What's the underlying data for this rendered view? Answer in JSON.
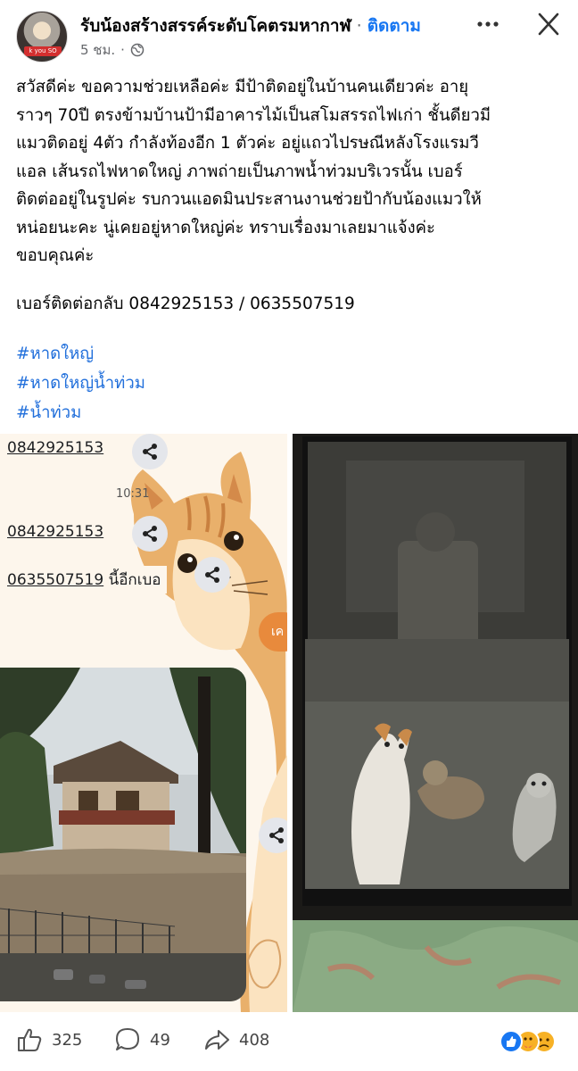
{
  "header": {
    "page_name": "รับน้องสร้างสรรค์ระดับโคตรมหากาฬ",
    "separator": " · ",
    "follow_label": "ติดตาม",
    "time_ago": "5 ชม.",
    "dot": "·",
    "avatar_tag": "k you SO"
  },
  "post": {
    "lines": [
      "สวัสดีค่ะ ขอความช่วยเหลือค่ะ มีป้าติดอยู่ในบ้านคนเดียวค่ะ อายุ",
      "ราวๆ 70ปี ตรงข้ามบ้านป้ามีอาคารไม้เป็นสโมสรรถไฟเก่า ชั้นดียวมี",
      "แมวติดอยู่ 4ตัว กำลังท้องอีก 1 ตัวค่ะ อยู่แถวไปรษณีหลังโรงแรมวี",
      "แอล เส้นรถไฟหาดใหญ่ ภาพถ่ายเป็นภาพน้ำท่วมบริเวรนั้น เบอร์",
      "ติดต่ออยู่ในรูปค่ะ รบกวนแอดมินประสานงานช่วยป้ากับน้องแมวให้",
      "หน่อยนะคะ  นู่เคยอยู่หาดใหญ่ค่ะ ทราบเรื่องมาเลยมาแจ้งค่ะ",
      "ขอบคุณค่ะ"
    ],
    "contact": "เบอร์ติดต่อกลับ 0842925153 / 0635507519",
    "hashtags": [
      "#หาดใหญ่",
      "#หาดใหญ่น้ำท่วม",
      "#น้ำท่วม"
    ]
  },
  "left_image": {
    "number_1": "0842925153",
    "time": "10:31",
    "number_2": "0842925153",
    "number_3": "0635507519",
    "number_3_suffix": " นี้อีกเบอ",
    "button_partial": "เค"
  },
  "footer": {
    "likes": "325",
    "comments": "49",
    "shares": "408"
  },
  "colors": {
    "link": "#216fdb",
    "follow": "#1877f2",
    "secondary_text": "#65676b",
    "like_blue": "#1877f2"
  },
  "icons": [
    "globe-icon",
    "more-icon",
    "close-icon",
    "share-icon",
    "like-icon",
    "comment-icon",
    "forward-icon",
    "like-reaction-icon",
    "care-reaction-icon",
    "sad-reaction-icon"
  ]
}
